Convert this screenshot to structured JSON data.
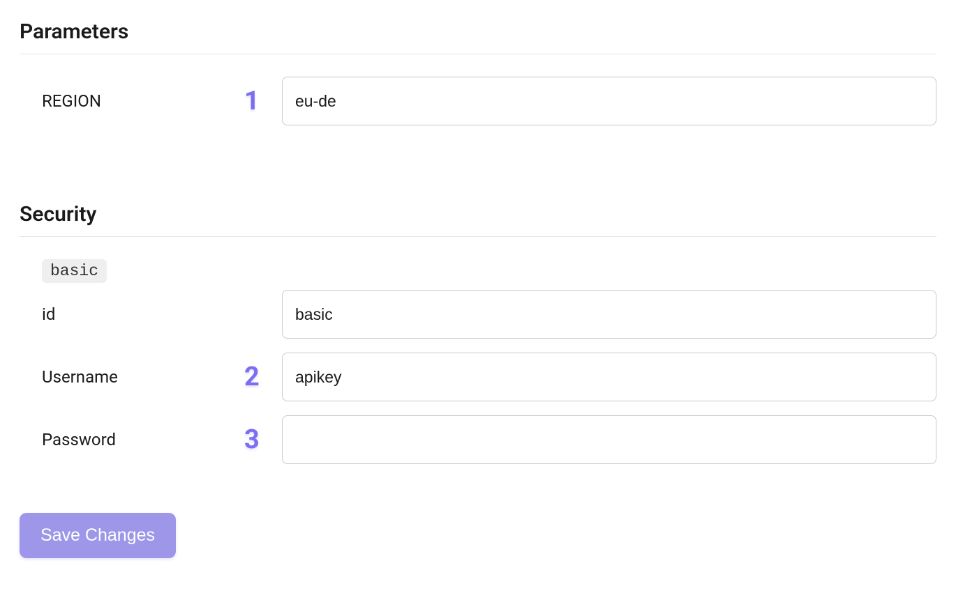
{
  "sections": {
    "parameters": {
      "title": "Parameters",
      "fields": {
        "region": {
          "label": "REGION",
          "step": "1",
          "value": "eu-de"
        }
      }
    },
    "security": {
      "title": "Security",
      "tag": "basic",
      "fields": {
        "id": {
          "label": "id",
          "value": "basic"
        },
        "username": {
          "label": "Username",
          "step": "2",
          "value": "apikey"
        },
        "password": {
          "label": "Password",
          "step": "3",
          "value": ""
        }
      }
    }
  },
  "actions": {
    "save": "Save Changes"
  }
}
